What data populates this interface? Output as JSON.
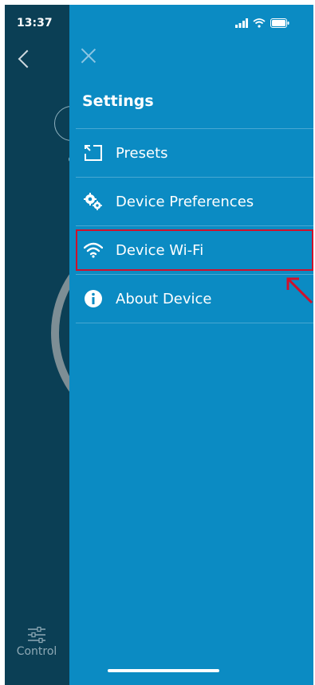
{
  "status": {
    "time": "13:37"
  },
  "drawer": {
    "title": "Settings",
    "items": [
      {
        "label": "Presets",
        "icon": "presets-icon"
      },
      {
        "label": "Device Preferences",
        "icon": "gears-icon"
      },
      {
        "label": "Device Wi-Fi",
        "icon": "wifi-icon"
      },
      {
        "label": "About Device",
        "icon": "info-icon"
      }
    ]
  },
  "bottom": {
    "control_label": "Control"
  },
  "colors": {
    "drawer": "#0b8bc3",
    "background": "#0b3f55",
    "highlight": "#d0102b"
  }
}
